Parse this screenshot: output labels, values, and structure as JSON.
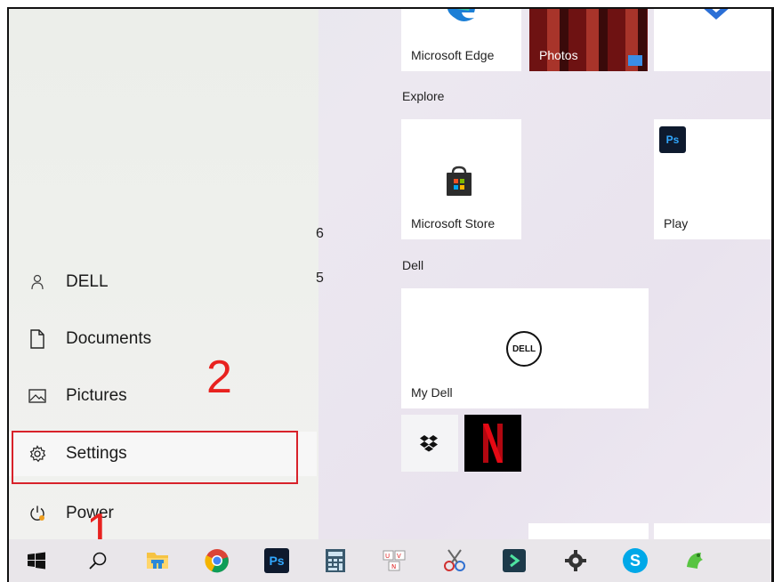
{
  "apps": {
    "edge": "Microsoft Edge",
    "photos": "Photos"
  },
  "groups": {
    "explore": "Explore",
    "dell": "Dell"
  },
  "tiles": {
    "store": "Microsoft Store",
    "play": "Play",
    "mydell": "My Dell",
    "dell_logo_text": "DELL",
    "ps_logo": "Ps"
  },
  "menu": {
    "user": "DELL",
    "documents": "Documents",
    "pictures": "Pictures",
    "settings": "Settings",
    "power": "Power"
  },
  "background_glyphs": {
    "g1": "6",
    "g2": "5"
  },
  "annotations": {
    "step1": "1",
    "step2": "2",
    "color": "#d8222a"
  },
  "taskbar": {
    "icons": [
      "windows-start-icon",
      "search-icon",
      "file-explorer-icon",
      "chrome-icon",
      "photoshop-icon",
      "calculator-icon",
      "unikey-icon",
      "snipping-tool-icon",
      "terminal-app-icon",
      "settings-gear-icon",
      "skype-icon",
      "evernote-icon"
    ],
    "ps_label": "Ps",
    "skype_label": "S"
  }
}
